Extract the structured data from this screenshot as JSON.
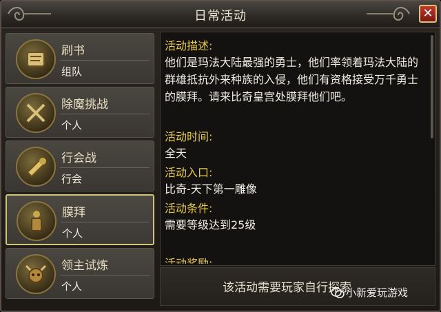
{
  "window": {
    "title": "日常活动",
    "close_label": "✕"
  },
  "sidebar": {
    "items": [
      {
        "name": "刷书",
        "type": "组队",
        "icon": "scroll-icon"
      },
      {
        "name": "除魔挑战",
        "type": "个人",
        "icon": "crossed-swords-icon"
      },
      {
        "name": "行会战",
        "type": "行会",
        "icon": "war-horn-icon"
      },
      {
        "name": "膜拜",
        "type": "个人",
        "icon": "statue-icon",
        "selected": true
      },
      {
        "name": "领主试炼",
        "type": "个人",
        "icon": "demon-lord-icon"
      }
    ]
  },
  "detail": {
    "desc_label": "活动描述:",
    "desc_text": "他们是玛法大陆最强的勇士，他们率领着玛法大陆的群雄抵抗外来种族的入侵，他们有资格接受万千勇士的膜拜。请来比奇皇宫处膜拜他们吧。",
    "time_label": "活动时间:",
    "time_value": "全天",
    "entry_label": "活动入口:",
    "entry_value": "比奇-天下第一雕像",
    "cond_label": "活动条件:",
    "cond_value": "需要等级达到25级",
    "reward_label": "活动奖励:"
  },
  "footer": {
    "text": "该活动需要玩家自行探索"
  },
  "watermark": {
    "text": "小新爱玩游戏"
  },
  "colors": {
    "label": "#e6c94a",
    "text": "#f0ece4",
    "selected_border": "#cfc67a"
  }
}
